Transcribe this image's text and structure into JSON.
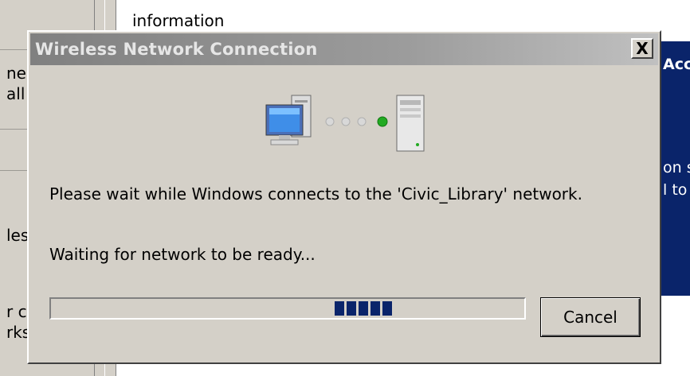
{
  "background": {
    "top_text": "information",
    "left_fragments": [
      "ne",
      "all",
      "les",
      "r c",
      "rks"
    ],
    "right_fragments": [
      "Acc",
      "on s",
      "l to"
    ]
  },
  "dialog": {
    "title": "Wireless Network Connection",
    "close_glyph": "X",
    "message": "Please wait while Windows connects to the 'Civic_Library' network.",
    "status": "Waiting for network to be ready...",
    "progress_blocks": 5,
    "cancel_label": "Cancel"
  },
  "colors": {
    "title_bar": "#808080",
    "progress_block": "#0a246a",
    "link_dot_active": "#22aa22"
  },
  "icons": [
    "computer-icon",
    "connection-dots-icon",
    "network-server-icon"
  ]
}
